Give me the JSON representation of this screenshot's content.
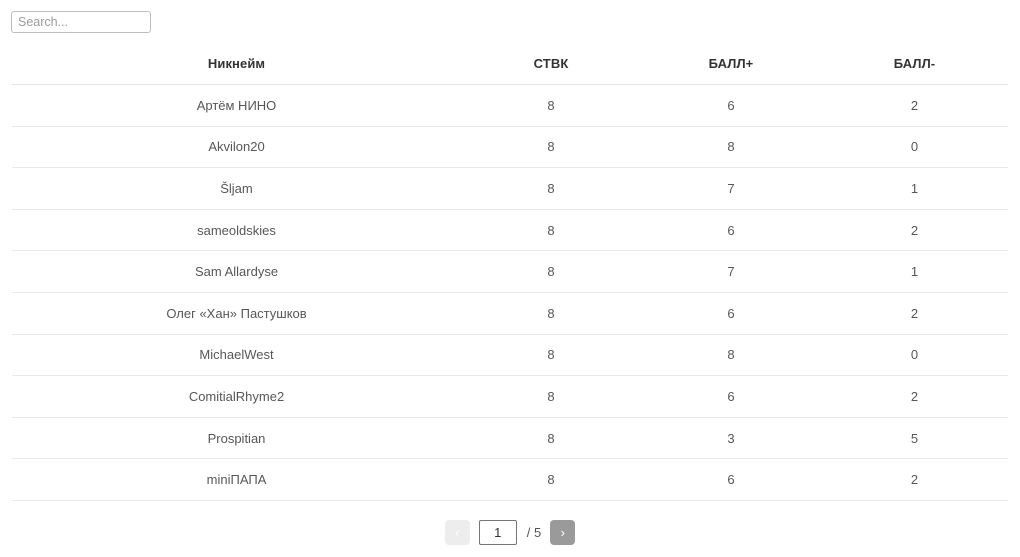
{
  "search": {
    "placeholder": "Search...",
    "value": ""
  },
  "table": {
    "columns": [
      {
        "key": "nickname",
        "label": "Никнейм"
      },
      {
        "key": "stvk",
        "label": "СТВК"
      },
      {
        "key": "plus",
        "label": "БАЛЛ+"
      },
      {
        "key": "minus",
        "label": "БАЛЛ-"
      }
    ],
    "rows": [
      {
        "nickname": "Артём НИНО",
        "stvk": "8",
        "plus": "6",
        "minus": "2"
      },
      {
        "nickname": "Akvilon20",
        "stvk": "8",
        "plus": "8",
        "minus": "0"
      },
      {
        "nickname": "Šljam",
        "stvk": "8",
        "plus": "7",
        "minus": "1"
      },
      {
        "nickname": "sameoldskies",
        "stvk": "8",
        "plus": "6",
        "minus": "2"
      },
      {
        "nickname": "Sam Allardyse",
        "stvk": "8",
        "plus": "7",
        "minus": "1"
      },
      {
        "nickname": "Олег «Хан» Пастушков",
        "stvk": "8",
        "plus": "6",
        "minus": "2"
      },
      {
        "nickname": "MichaelWest",
        "stvk": "8",
        "plus": "8",
        "minus": "0"
      },
      {
        "nickname": "ComitialRhyme2",
        "stvk": "8",
        "plus": "6",
        "minus": "2"
      },
      {
        "nickname": "Prospitian",
        "stvk": "8",
        "plus": "3",
        "minus": "5"
      },
      {
        "nickname": "miniПАПА",
        "stvk": "8",
        "plus": "6",
        "minus": "2"
      }
    ]
  },
  "pagination": {
    "prev_label": "‹",
    "next_label": "›",
    "current_page": "1",
    "total_label": "/ 5",
    "prev_disabled": true
  },
  "colors": {
    "row_divider": "#e9e9e9",
    "header_divider": "#e4e4e4",
    "header_text": "#333333",
    "cell_text": "#575757",
    "next_button_bg": "#9a9a9a",
    "prev_button_bg": "#ededed"
  }
}
